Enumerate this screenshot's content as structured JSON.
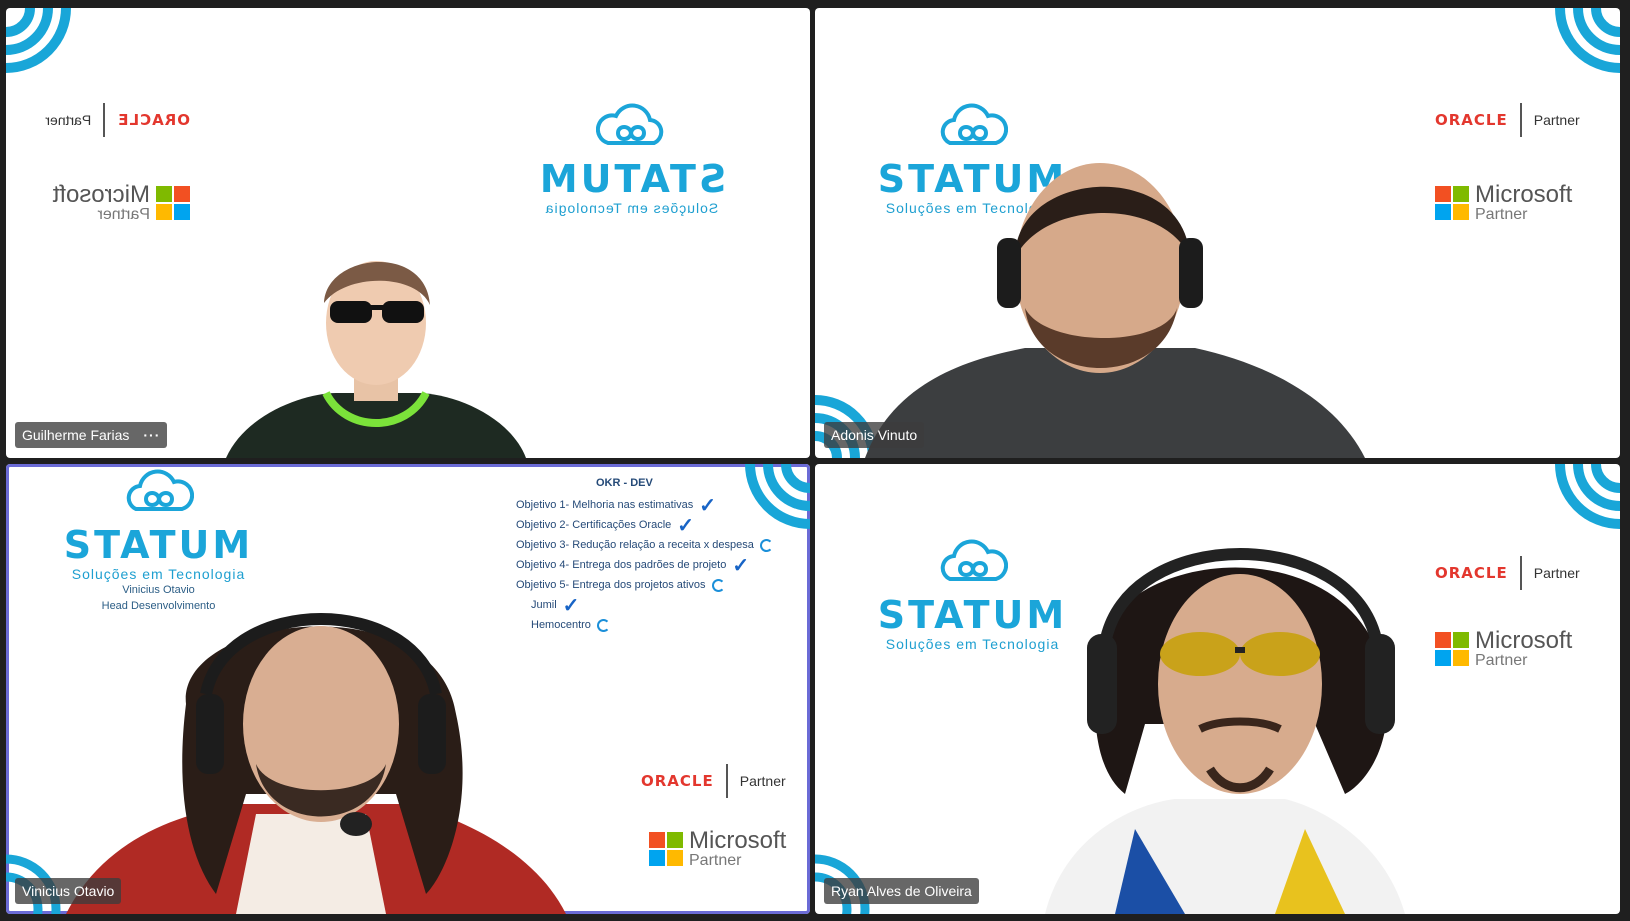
{
  "participants": [
    {
      "name": "Guilherme Farias",
      "more": "···"
    },
    {
      "name": "Adonis Vinuto"
    },
    {
      "name": "Vinicius Otavio"
    },
    {
      "name": "Ryan Alves de Oliveira"
    }
  ],
  "branding": {
    "statum": "STATUM",
    "tagline": "Soluções em Tecnologia",
    "oracle": "ORACLE",
    "oracle_partner": "Partner",
    "microsoft": "Microsoft",
    "microsoft_partner": "Partner"
  },
  "presenter": {
    "name": "Vinicius Otavio",
    "role": "Head Desenvolvimento"
  },
  "okr": {
    "title": "OKR - DEV",
    "items": [
      "Objetivo 1- Melhoria nas estimativas",
      "Objetivo 2- Certificações Oracle",
      "Objetivo 3- Redução relação a receita x despesa",
      "Objetivo 4- Entrega dos padrões de projeto",
      "Objetivo 5- Entrega dos projetos ativos",
      "Jumil",
      "Hemocentro"
    ],
    "status": [
      "done",
      "done",
      "pending",
      "done",
      "pending",
      "done",
      "pending"
    ]
  },
  "colors": {
    "accent_blue": "#1ba5d9",
    "oracle_red": "#e3372e",
    "active_border": "#6b6bd6"
  }
}
